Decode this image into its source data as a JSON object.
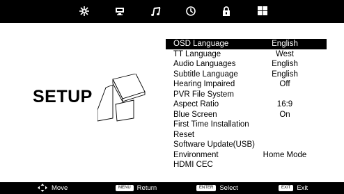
{
  "tabs": [
    {
      "icon": "picture-icon"
    },
    {
      "icon": "monitor-icon"
    },
    {
      "icon": "music-note-icon"
    },
    {
      "icon": "clock-icon"
    },
    {
      "icon": "lock-icon"
    },
    {
      "icon": "setup-grid-icon",
      "active": true
    }
  ],
  "page": {
    "title": "SETUP"
  },
  "menu": {
    "items": [
      {
        "label": "OSD Language",
        "value": "English",
        "selected": true
      },
      {
        "label": "TT Language",
        "value": "West"
      },
      {
        "label": "Audio Languages",
        "value": "English"
      },
      {
        "label": "Subtitle Language",
        "value": "English"
      },
      {
        "label": "Hearing Impaired",
        "value": "Off"
      },
      {
        "label": "PVR File System",
        "value": ""
      },
      {
        "label": "Aspect Ratio",
        "value": "16:9"
      },
      {
        "label": "Blue Screen",
        "value": "On"
      },
      {
        "label": "First Time Installation",
        "value": ""
      },
      {
        "label": "Reset",
        "value": ""
      },
      {
        "label": "Software Update(USB)",
        "value": ""
      },
      {
        "label": "Environment",
        "value": "Home Mode"
      },
      {
        "label": "HDMI CEC",
        "value": ""
      }
    ]
  },
  "footer": {
    "move_label": "Move",
    "menu_key": "MENU",
    "return_label": "Return",
    "enter_key": "ENTER",
    "select_label": "Select",
    "exit_key": "EXIT",
    "exit_label": "Exit"
  }
}
